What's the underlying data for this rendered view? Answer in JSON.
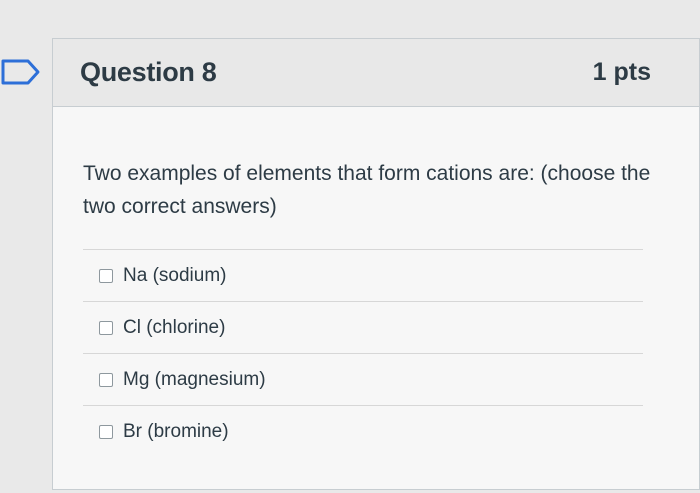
{
  "question": {
    "title": "Question 8",
    "points": "1 pts",
    "text": "Two examples of elements that form cations are: (choose the two correct answers)",
    "answers": [
      {
        "label": "Na (sodium)",
        "checked": false
      },
      {
        "label": "Cl (chlorine)",
        "checked": false
      },
      {
        "label": "Mg (magnesium)",
        "checked": false
      },
      {
        "label": "Br (bromine)",
        "checked": false
      }
    ]
  },
  "colors": {
    "flag_stroke": "#2d6fd8",
    "text": "#2d3b45",
    "border": "#c7cdd1"
  }
}
